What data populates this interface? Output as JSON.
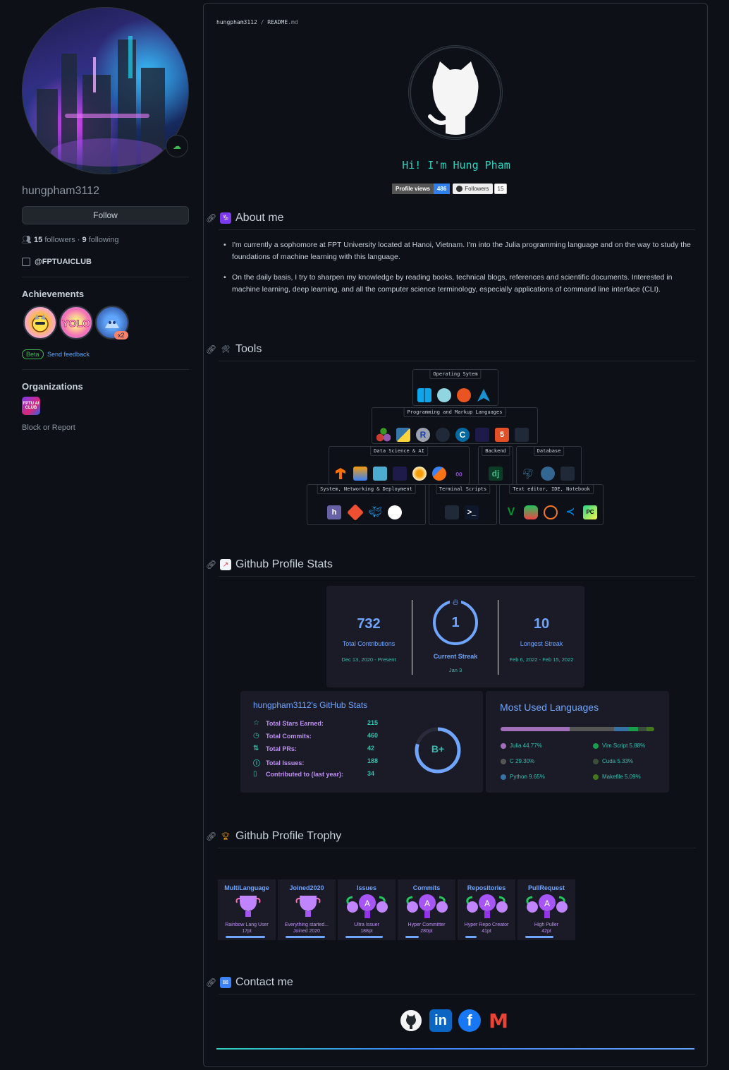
{
  "sidebar": {
    "username": "hungpham3112",
    "follow_label": "Follow",
    "followers_count": "15",
    "followers_label": "followers",
    "following_count": "9",
    "following_label": "following",
    "organization_handle": "@FPTUAICLUB",
    "achievements_title": "Achievements",
    "achievement_multiplier": "x2",
    "beta_label": "Beta",
    "feedback_label": "Send feedback",
    "organizations_title": "Organizations",
    "org_icon_text": "FPTU AI CLUB",
    "block_label": "Block or Report"
  },
  "readme": {
    "breadcrumb_user": "hungpham3112",
    "breadcrumb_sep": "/",
    "breadcrumb_file": "README",
    "breadcrumb_ext": ".md",
    "greeting": "Hi! I'm Hung Pham",
    "badge_views_label": "Profile views",
    "badge_views_value": "486",
    "badge_followers_label": "Followers",
    "badge_followers_value": "15"
  },
  "about": {
    "title": "About me",
    "items": [
      "I'm currently a sophomore at FPT University located at Hanoi, Vietnam. I'm into the Julia programming language and on the way to study the foundations of machine learning with this language.",
      "On the daily basis, I try to sharpen my knowledge by reading books, technical blogs, references and scientific documents. Interested in machine learning, deep learning, and all the computer science terminology, especially applications of command line interface (CLI)."
    ]
  },
  "tools": {
    "title": "Tools",
    "groups": {
      "os": "Operating Sytem",
      "prog": "Programming and Markup Languages",
      "ds": "Data Science & AI",
      "backend": "Backend",
      "db": "Database",
      "sys": "System, Networking & Deployment",
      "term": "Terminal Scripts",
      "editor": "Text editor, IDE, Notebook"
    }
  },
  "stats": {
    "title": "Github Profile Stats",
    "streak": {
      "total": "732",
      "total_label": "Total Contributions",
      "total_range": "Dec 13, 2020 - Present",
      "current": "1",
      "current_label": "Current Streak",
      "current_range": "Jan 3",
      "longest": "10",
      "longest_label": "Longest Streak",
      "longest_range": "Feb 6, 2022 - Feb 15, 2022"
    },
    "github": {
      "title": "hungpham3112's GitHub Stats",
      "rows": [
        {
          "label": "Total Stars Earned:",
          "value": "215"
        },
        {
          "label": "Total Commits:",
          "value": "460"
        },
        {
          "label": "Total PRs:",
          "value": "42"
        },
        {
          "label": "Total Issues:",
          "value": "188"
        },
        {
          "label": "Contributed to (last year):",
          "value": "34"
        }
      ],
      "grade": "B+"
    },
    "languages": {
      "title": "Most Used Languages",
      "items": [
        {
          "label": "Julia 44.77%",
          "color": "#a270ba",
          "percent": 44.77
        },
        {
          "label": "C 29.30%",
          "color": "#555555",
          "percent": 29.3
        },
        {
          "label": "Python 9.65%",
          "color": "#3572a5",
          "percent": 9.65
        },
        {
          "label": "Vim Script 5.88%",
          "color": "#199f4b",
          "percent": 5.88
        },
        {
          "label": "Cuda 5.33%",
          "color": "#3a4e3a",
          "percent": 5.33
        },
        {
          "label": "Makefile 5.09%",
          "color": "#427819",
          "percent": 5.09
        }
      ]
    }
  },
  "trophy": {
    "title": "Github Profile Trophy",
    "items": [
      {
        "title": "MultiLanguage",
        "name": "Rainbow Lang User",
        "points": "17pt",
        "progress": 0.9
      },
      {
        "title": "Joined2020",
        "name": "Everything started...",
        "points": "Joined 2020",
        "progress": 0.9
      },
      {
        "title": "Issues",
        "name": "Ultra Issuer",
        "points": "188pt",
        "progress": 0.85
      },
      {
        "title": "Commits",
        "name": "Hyper Committer",
        "points": "280pt",
        "progress": 0.3
      },
      {
        "title": "Repositories",
        "name": "Hyper Repo Creator",
        "points": "41pt",
        "progress": 0.25
      },
      {
        "title": "PullRequest",
        "name": "High Puller",
        "points": "42pt",
        "progress": 0.65
      }
    ]
  },
  "contact": {
    "title": "Contact me",
    "links": [
      "github-icon",
      "linkedin-icon",
      "facebook-icon",
      "gmail-icon"
    ],
    "linkedin_text": "in",
    "facebook_text": "f",
    "gmail_text": "M"
  }
}
